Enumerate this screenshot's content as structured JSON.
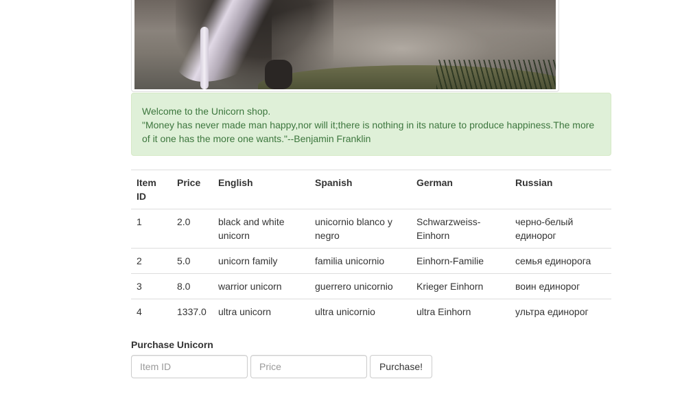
{
  "alert": {
    "welcome": "Welcome to the Unicorn shop.",
    "quote": "\"Money has never made man happy,nor will it;there is nothing in its nature to produce happiness.The more of it one has the more one wants.\"--Benjamin Franklin"
  },
  "table": {
    "headers": [
      "Item ID",
      "Price",
      "English",
      "Spanish",
      "German",
      "Russian"
    ],
    "rows": [
      [
        "1",
        "2.0",
        "black and white unicorn",
        "unicornio blanco y negro",
        "Schwarzweiss-Einhorn",
        "черно-белый единорог"
      ],
      [
        "2",
        "5.0",
        "unicorn family",
        "familia unicornio",
        "Einhorn-Familie",
        "семья единорога"
      ],
      [
        "3",
        "8.0",
        "warrior unicorn",
        "guerrero unicornio",
        "Krieger Einhorn",
        "воин единорог"
      ],
      [
        "4",
        "1337.0",
        "ultra unicorn",
        "ultra unicornio",
        "ultra Einhorn",
        "ультра единорог"
      ]
    ]
  },
  "purchase": {
    "title": "Purchase Unicorn",
    "item_placeholder": "Item ID",
    "price_placeholder": "Price",
    "button_label": "Purchase!"
  }
}
